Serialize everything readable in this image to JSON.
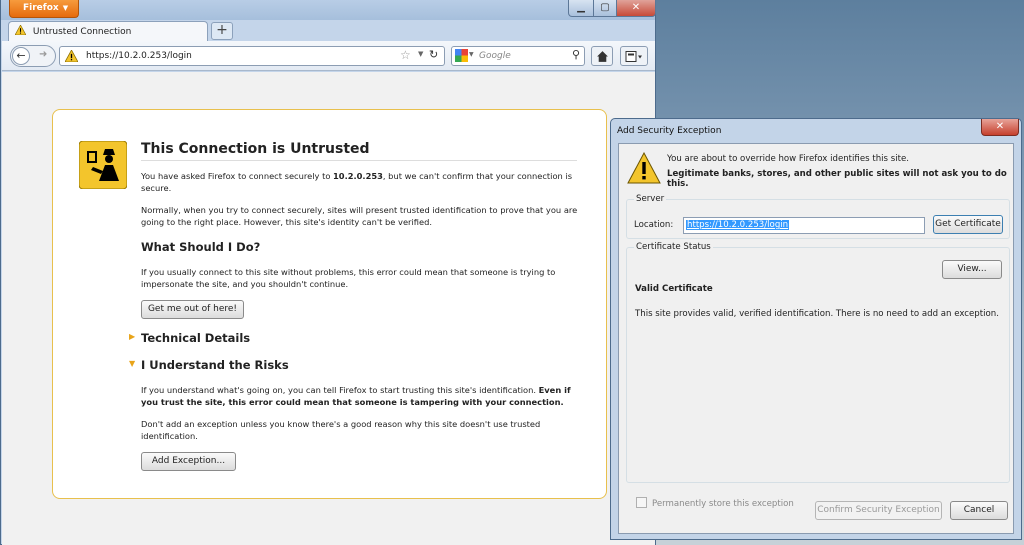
{
  "browser": {
    "menu_button": "Firefox",
    "tab_title": "Untrusted Connection",
    "new_tab": "+",
    "url": "https://10.2.0.253/login",
    "search_placeholder": "Google"
  },
  "error_page": {
    "title": "This Connection is Untrusted",
    "intro_pre": "You have asked Firefox to connect securely to ",
    "intro_host": "10.2.0.253",
    "intro_post": ", but we can't confirm that your connection is secure.",
    "normal_text": "Normally, when you try to connect securely, sites will present trusted identification to prove that you are going to the right place. However, this site's identity can't be verified.",
    "what_heading": "What Should I Do?",
    "what_text": "If you usually connect to this site without problems, this error could mean that someone is trying to impersonate the site, and you shouldn't continue.",
    "get_out_button": "Get me out of here!",
    "tech_heading": "Technical Details",
    "risks_heading": "I Understand the Risks",
    "risks_text_pre": "If you understand what's going on, you can tell Firefox to start trusting this site's identification. ",
    "risks_text_bold": "Even if you trust the site, this error could mean that someone is tampering with your connection.",
    "dont_add_text": "Don't add an exception unless you know there's a good reason why this site doesn't use trusted identification.",
    "add_exception_button": "Add Exception..."
  },
  "dialog": {
    "title": "Add Security Exception",
    "warning_line1": "You are about to override how Firefox identifies this site.",
    "warning_line2": "Legitimate banks, stores, and other public sites will not ask you to do this.",
    "server_label": "Server",
    "location_label": "Location:",
    "location_value": "https://10.2.0.253/login",
    "get_certificate_button": "Get Certificate",
    "status_label": "Certificate Status",
    "view_button": "View...",
    "status_heading": "Valid Certificate",
    "status_text": "This site provides valid, verified identification.  There is no need to add an exception.",
    "permanent_label": "Permanently store this exception",
    "confirm_button": "Confirm Security Exception",
    "cancel_button": "Cancel"
  },
  "colors": {
    "firefox_orange": "#e66b0d",
    "error_border": "#e8c04d",
    "warning_yellow": "#f3c52c",
    "close_red": "#c6402d",
    "selection_blue": "#3399ff"
  }
}
